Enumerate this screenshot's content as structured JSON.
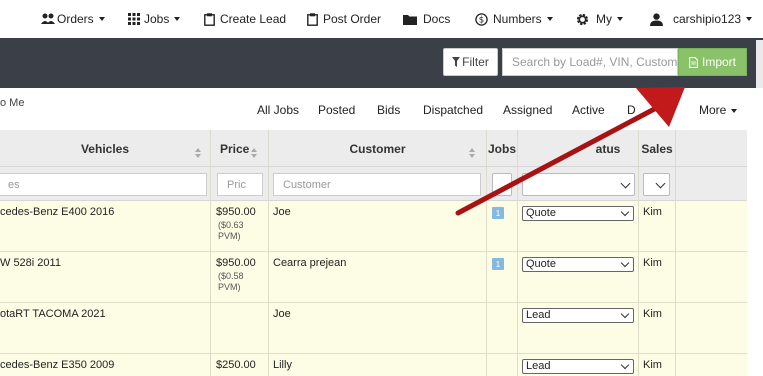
{
  "nav": {
    "orders": "Orders",
    "jobs": "Jobs",
    "create_lead": "Create Lead",
    "post_order": "Post Order",
    "docs": "Docs",
    "numbers": "Numbers",
    "my": "My",
    "user": "carshipio123"
  },
  "toolbar": {
    "filter_label": "Filter",
    "search_placeholder": "Search by Load#, VIN, Customer",
    "import_label": "Import"
  },
  "tabs": {
    "to_me": "o Me",
    "items": [
      "All Jobs",
      "Posted",
      "Bids",
      "Dispatched",
      "Assigned",
      "Active",
      "D",
      "More"
    ]
  },
  "table": {
    "headers": {
      "vehicles": "Vehicles",
      "price": "Price",
      "customer": "Customer",
      "jobs": "Jobs",
      "status": "atus",
      "sales": "Sales"
    },
    "filters": {
      "vehicles_placeholder": "es",
      "price_placeholder": "Pric",
      "customer_placeholder": "Customer"
    },
    "rows": [
      {
        "vehicle": "cedes-Benz E400 2016",
        "price": "$950.00",
        "pvm1": "($0.63",
        "pvm2": "PVM)",
        "customer": "Joe",
        "jobs": "1",
        "status": "Quote",
        "sales": "Kim"
      },
      {
        "vehicle": "W 528i 2011",
        "price": "$950.00",
        "pvm1": "($0.58",
        "pvm2": "PVM)",
        "customer": "Cearra prejean",
        "jobs": "1",
        "status": "Quote",
        "sales": "Kim"
      },
      {
        "vehicle": "otaRT TACOMA 2021",
        "price": "",
        "pvm1": "",
        "pvm2": "",
        "customer": "Joe",
        "jobs": "",
        "status": "Lead",
        "sales": "Kim"
      },
      {
        "vehicle": "cedes-Benz E350 2009",
        "price": "$250.00",
        "pvm1": "",
        "pvm2": "",
        "customer": "Lilly",
        "jobs": "",
        "status": "Lead",
        "sales": "Kim"
      }
    ]
  },
  "colors": {
    "dark_bar": "#3b3f47",
    "import_green": "#8ac26a",
    "row_bg": "#fdfde6",
    "badge_blue": "#86b9e0",
    "annotation_arrow": "#c21a1a"
  },
  "icons": [
    "users-icon",
    "grid-icon",
    "clipboard-icon",
    "clipboard-icon",
    "folder-icon",
    "dollar-icon",
    "gear-icon",
    "user-icon",
    "filter-icon",
    "file-icon"
  ]
}
